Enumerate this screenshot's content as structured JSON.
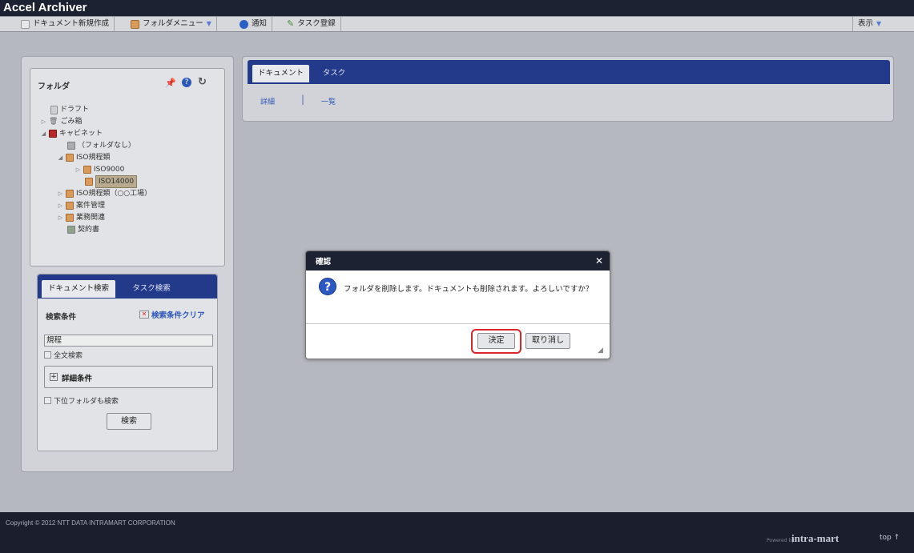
{
  "app": {
    "title": "Accel Archiver"
  },
  "toolbar": {
    "new_document": "ドキュメント新規作成",
    "folder_menu": "フォルダメニュー",
    "notify": "通知",
    "task_register": "タスク登録",
    "view": "表示"
  },
  "folder_panel": {
    "title": "フォルダ",
    "tree": [
      {
        "label": "ドラフト"
      },
      {
        "label": "ごみ箱"
      },
      {
        "label": "キャビネット"
      },
      {
        "label": "（フォルダなし）"
      },
      {
        "label": "ISO規程類"
      },
      {
        "label": "ISO9000"
      },
      {
        "label": "ISO14000"
      },
      {
        "label": "ISO規程類（○○工場）"
      },
      {
        "label": "案件管理"
      },
      {
        "label": "業務関連"
      },
      {
        "label": "契約書"
      }
    ]
  },
  "search_panel": {
    "tabs": [
      "ドキュメント検索",
      "タスク検索"
    ],
    "conditions_label": "検索条件",
    "clear_label": "検索条件クリア",
    "keyword_value": "規程",
    "fulltext_label": "全文検索",
    "detail_label": "詳細条件",
    "subfolder_label": "下位フォルダも検索",
    "search_button": "検索"
  },
  "main": {
    "tabs": [
      "ドキュメント",
      "タスク"
    ],
    "links": [
      "詳細",
      "一覧"
    ]
  },
  "dialog": {
    "title": "確認",
    "message": "フォルダを削除します。ドキュメントも削除されます。よろしいですか？",
    "ok_button": "決定",
    "cancel_button": "取り消し"
  },
  "footer": {
    "copyright": "Copyright © 2012 NTT DATA INTRAMART CORPORATION",
    "powered_by": "Powered by",
    "brand": "intra-mart",
    "top_link": "top ↑"
  },
  "colors": {
    "header": "#1d2233",
    "tab_bar": "#233a8a",
    "highlight": "#d9252b"
  }
}
